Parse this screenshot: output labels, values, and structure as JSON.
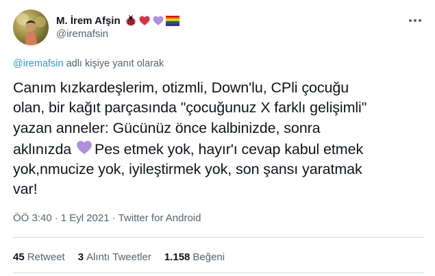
{
  "author": {
    "display_name": "M. İrem Afşin",
    "handle": "@iremafsin",
    "name_emojis": [
      "ladybug-icon",
      "red-heart-icon",
      "purple-heart-icon",
      "rainbow-flag-icon"
    ]
  },
  "reply_context": {
    "mention": "@iremafsin",
    "suffix": " adlı kişiye yanıt olarak"
  },
  "tweet": {
    "lines": [
      "Canım kızkardeşlerim, otizmli, Down'lu, CPli çocuğu",
      "olan, bir kağıt parçasında \"çocuğunuz X farklı gelişimli\"",
      "yazan anneler: Gücünüz önce kalbinizde, sonra",
      "aklınızda",
      "Pes etmek yok, hayır'ı cevap kabul etmek",
      "yok,nmucize yok, iyileştirmek yok, son şansı yaratmak",
      "var!"
    ],
    "inline_icon": "purple-heart-icon"
  },
  "meta": {
    "time": "ÖÖ 3:40",
    "separator": "·",
    "date": "1 Eyl 2021",
    "source": "Twitter for Android"
  },
  "stats": {
    "retweets_count": "45",
    "retweets_label": "Retweet",
    "quotes_count": "3",
    "quotes_label": "Alıntı Tweetler",
    "likes_count": "1.158",
    "likes_label": "Beğeni"
  },
  "colors": {
    "text": "#0f1419",
    "muted": "#536471",
    "link": "#1d9bf0",
    "divider": "#cfd9de",
    "purple_heart": "#b18ee0",
    "red_heart": "#dd2e44"
  }
}
